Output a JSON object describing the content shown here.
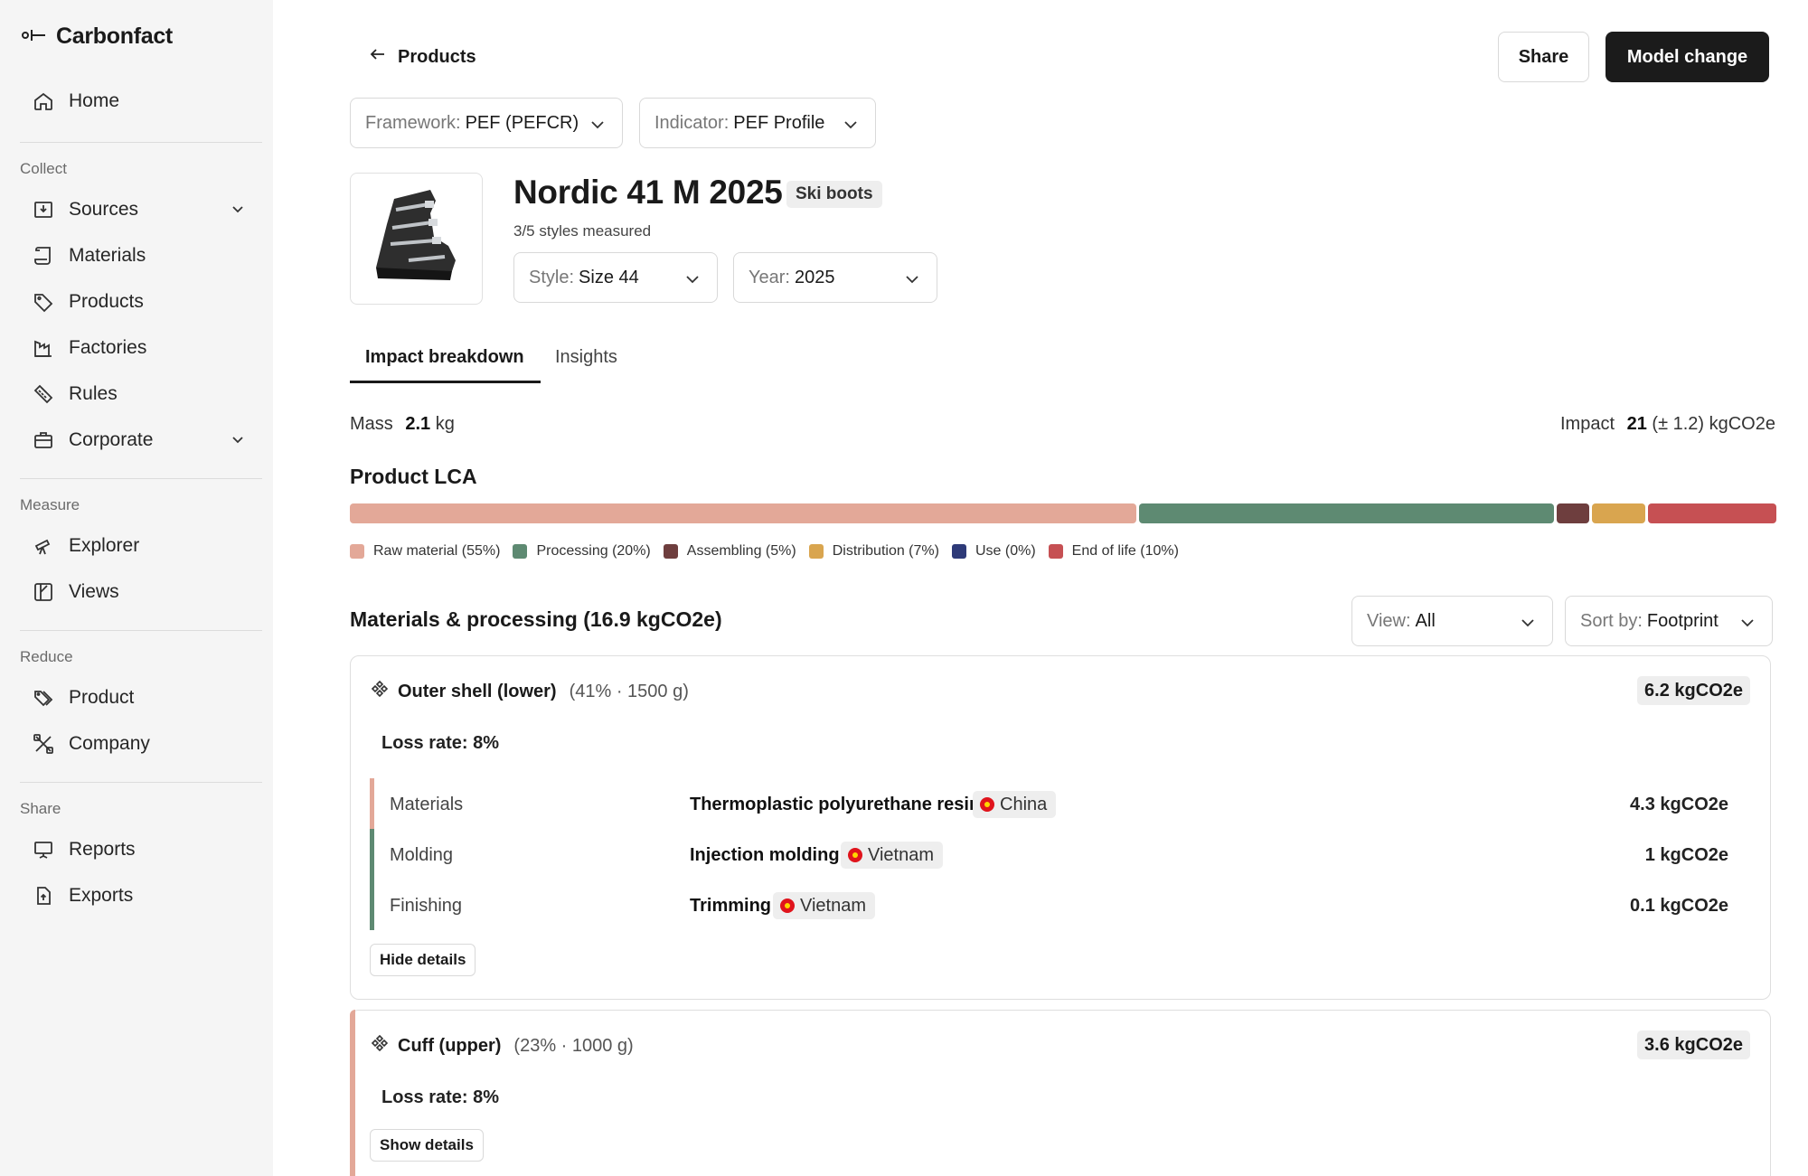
{
  "app": {
    "name": "Carbonfact"
  },
  "sidebar": {
    "home": "Home",
    "groups": [
      {
        "label": "Collect",
        "items": [
          {
            "label": "Sources",
            "icon": "inbox-icon",
            "expandable": true
          },
          {
            "label": "Materials",
            "icon": "scroll-icon"
          },
          {
            "label": "Products",
            "icon": "tag-icon"
          },
          {
            "label": "Factories",
            "icon": "factory-icon"
          },
          {
            "label": "Rules",
            "icon": "ruler-icon"
          },
          {
            "label": "Corporate",
            "icon": "briefcase-icon",
            "expandable": true
          }
        ]
      },
      {
        "label": "Measure",
        "items": [
          {
            "label": "Explorer",
            "icon": "telescope-icon"
          },
          {
            "label": "Views",
            "icon": "views-icon"
          }
        ]
      },
      {
        "label": "Reduce",
        "items": [
          {
            "label": "Product",
            "icon": "tags-icon"
          },
          {
            "label": "Company",
            "icon": "tools-icon"
          }
        ]
      },
      {
        "label": "Share",
        "items": [
          {
            "label": "Reports",
            "icon": "presentation-icon"
          },
          {
            "label": "Exports",
            "icon": "file-export-icon"
          }
        ]
      }
    ]
  },
  "header": {
    "back_label": "Products",
    "share_label": "Share",
    "model_change_label": "Model change"
  },
  "filters": {
    "framework": {
      "label": "Framework:",
      "value": "PEF (PEFCR)"
    },
    "indicator": {
      "label": "Indicator:",
      "value": "PEF Profile"
    },
    "style": {
      "label": "Style:",
      "value": "Size 44"
    },
    "year": {
      "label": "Year:",
      "value": "2025"
    },
    "view": {
      "label": "View:",
      "value": "All"
    },
    "sort": {
      "label": "Sort by:",
      "value": "Footprint"
    }
  },
  "product": {
    "title": "Nordic 41 M 2025",
    "category": "Ski boots",
    "styles_measured": "3/5 styles measured"
  },
  "tabs": {
    "active": "Impact breakdown",
    "other": "Insights"
  },
  "summary": {
    "mass_label": "Mass",
    "mass_value": "2.1",
    "mass_unit": "kg",
    "impact_label": "Impact",
    "impact_value": "21",
    "impact_rest": "(± 1.2) kgCO2e"
  },
  "lca": {
    "title": "Product LCA",
    "segments": [
      {
        "label": "Raw material (55%)",
        "share": 55,
        "color": "#e3a898"
      },
      {
        "label": "Processing (20%)",
        "share": 29,
        "color": "#5e8a72"
      },
      {
        "label": "Assembling (5%)",
        "share": 2.3,
        "color": "#6e3e3e"
      },
      {
        "label": "Distribution (7%)",
        "share": 3.7,
        "color": "#d9a54f"
      },
      {
        "label": "Use (0%)",
        "share": 0,
        "color": "#2e3a78"
      },
      {
        "label": "End of life (10%)",
        "share": 9,
        "color": "#c65053"
      }
    ]
  },
  "materials": {
    "title": "Materials & processing (16.9 kgCO2e)",
    "components": [
      {
        "name": "Outer shell (lower)",
        "meta": "(41% · 1500 g)",
        "total": "6.2 kgCO2e",
        "loss_rate": "Loss rate: 8%",
        "rows": [
          {
            "phase": "Materials",
            "process": "Thermoplastic polyurethane resin",
            "country": "China",
            "value": "4.3 kgCO2e",
            "color": "#e3a898"
          },
          {
            "phase": "Molding",
            "process": "Injection molding",
            "country": "Vietnam",
            "value": "1 kgCO2e",
            "color": "#5e8a72"
          },
          {
            "phase": "Finishing",
            "process": "Trimming",
            "country": "Vietnam",
            "value": "0.1 kgCO2e",
            "color": "#5e8a72"
          }
        ],
        "toggle_label": "Hide details"
      },
      {
        "name": "Cuff (upper)",
        "meta": "(23% · 1000 g)",
        "total": "3.6 kgCO2e",
        "loss_rate": "Loss rate: 8%",
        "toggle_label": "Show details",
        "accent": "#e3a898"
      }
    ]
  }
}
